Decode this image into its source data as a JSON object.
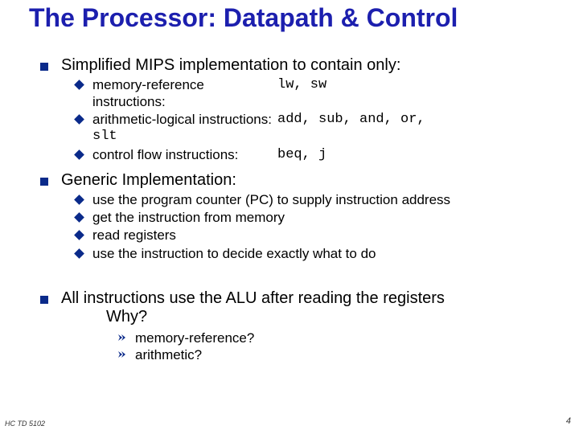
{
  "title": "The Processor:  Datapath & Control",
  "section1": {
    "heading": "Simplified MIPS implementation to contain only:",
    "items": [
      {
        "label": "memory-reference instructions:",
        "code": "lw, sw"
      },
      {
        "label_a": "arithmetic-logical instructions:",
        "code_a": "add, sub, and, or,",
        "label_b": "slt"
      },
      {
        "label": "control flow instructions:",
        "code": "beq, j"
      }
    ]
  },
  "section2": {
    "heading": "Generic Implementation:",
    "items": [
      "use the program counter (PC) to supply instruction address",
      "get the instruction from memory",
      "read registers",
      "use the instruction to decide exactly what to do"
    ]
  },
  "section3": {
    "line1": "All instructions use the ALU after reading the registers",
    "line2": "Why?",
    "items": [
      "memory-reference?",
      "arithmetic?"
    ]
  },
  "footer": {
    "left": "HC  TD 5102",
    "rightnum": "4"
  }
}
